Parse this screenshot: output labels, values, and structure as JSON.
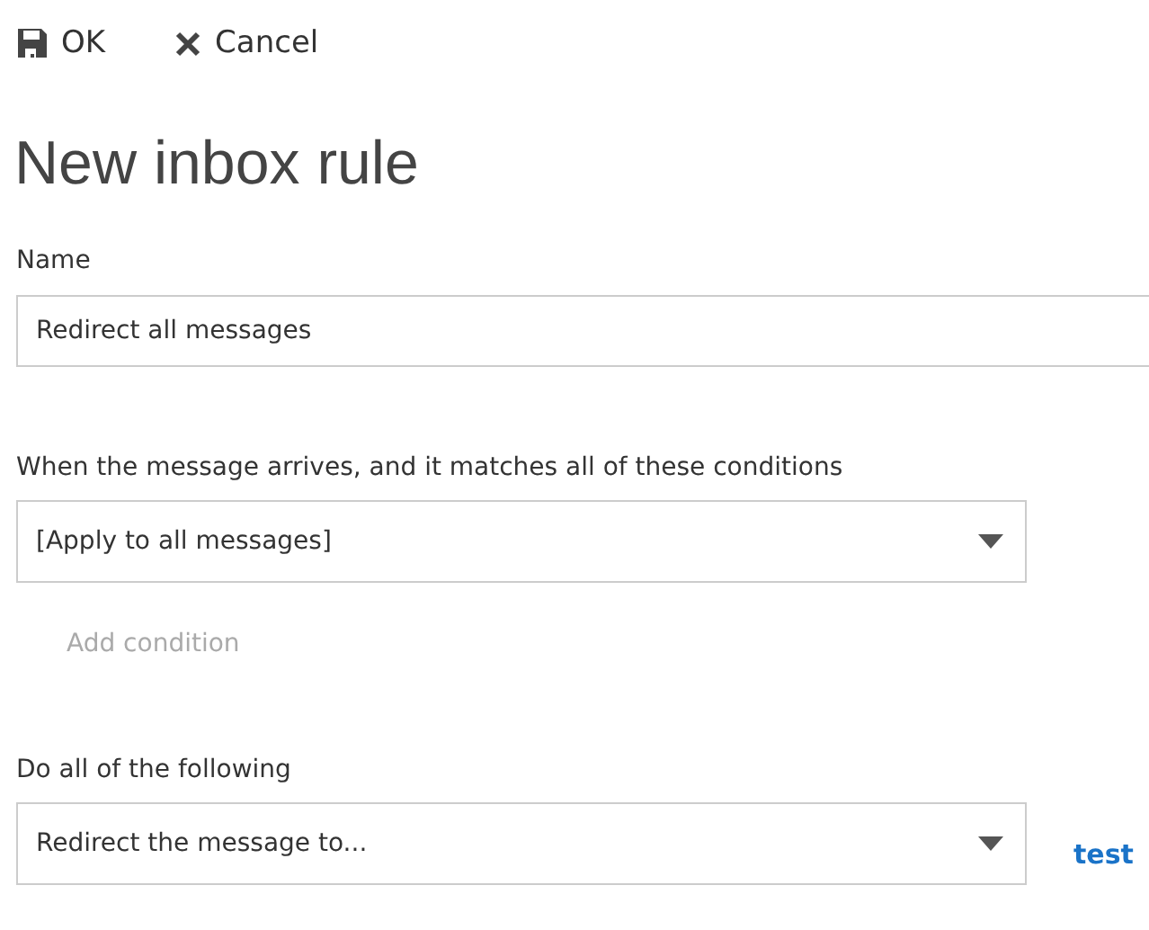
{
  "toolbar": [
    {
      "kind": "save",
      "label": "OK"
    },
    {
      "kind": "cancel",
      "label": "Cancel"
    }
  ],
  "title": "New inbox rule",
  "name_field": {
    "label": "Name",
    "value": "Redirect all messages"
  },
  "conditions": {
    "label": "When the message arrives, and it matches all of these conditions",
    "dropdown": "[Apply to all messages]",
    "add_link": {
      "label": "Add condition",
      "disabled": true
    }
  },
  "actions": {
    "label": "Do all of the following",
    "dropdown": "Redirect the message to...",
    "side_link": "test"
  }
}
